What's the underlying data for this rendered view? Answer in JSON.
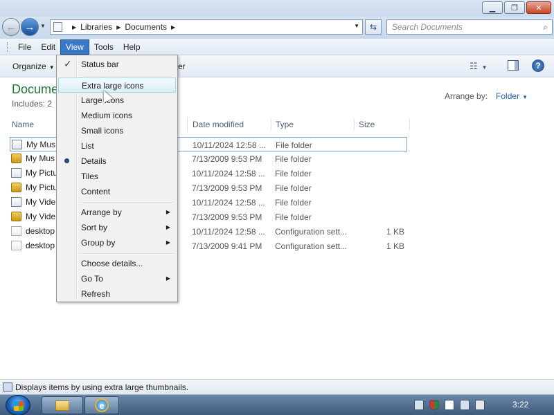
{
  "window": {
    "controls": [
      "minimize",
      "maximize",
      "close"
    ]
  },
  "address": {
    "path": [
      "Libraries",
      "Documents"
    ],
    "search_placeholder": "Search Documents"
  },
  "menubar": {
    "items": [
      "File",
      "Edit",
      "View",
      "Tools",
      "Help"
    ],
    "active": "View"
  },
  "toolbar": {
    "organize": "Organize",
    "partial_hidden": "er"
  },
  "library": {
    "title": "Docume",
    "includes": "Includes:  2",
    "arrange_label": "Arrange by:",
    "arrange_value": "Folder"
  },
  "columns": {
    "name": "Name",
    "date": "Date modified",
    "type": "Type",
    "size": "Size"
  },
  "files": [
    {
      "name": "My Mus",
      "date": "10/11/2024 12:58 ...",
      "type": "File folder",
      "size": "",
      "icon": "library-folder-icon"
    },
    {
      "name": "My Mus",
      "date": "7/13/2009 9:53 PM",
      "type": "File folder",
      "size": "",
      "icon": "locked-folder-icon"
    },
    {
      "name": "My Pictu",
      "date": "10/11/2024 12:58 ...",
      "type": "File folder",
      "size": "",
      "icon": "library-folder-icon"
    },
    {
      "name": "My Pictu",
      "date": "7/13/2009 9:53 PM",
      "type": "File folder",
      "size": "",
      "icon": "locked-folder-icon"
    },
    {
      "name": "My Vide",
      "date": "10/11/2024 12:58 ...",
      "type": "File folder",
      "size": "",
      "icon": "library-folder-icon"
    },
    {
      "name": "My Vide",
      "date": "7/13/2009 9:53 PM",
      "type": "File folder",
      "size": "",
      "icon": "locked-folder-icon"
    },
    {
      "name": "desktop",
      "date": "10/11/2024 12:58 ...",
      "type": "Configuration sett...",
      "size": "1 KB",
      "icon": "config-file-icon"
    },
    {
      "name": "desktop",
      "date": "7/13/2009 9:41 PM",
      "type": "Configuration sett...",
      "size": "1 KB",
      "icon": "config-file-icon"
    }
  ],
  "view_menu": {
    "items": [
      {
        "label": "Status bar",
        "mark": "check"
      },
      {
        "label": "Extra large icons",
        "mark": "",
        "hover": true
      },
      {
        "label": "Large icons",
        "mark": ""
      },
      {
        "label": "Medium icons",
        "mark": ""
      },
      {
        "label": "Small icons",
        "mark": ""
      },
      {
        "label": "List",
        "mark": ""
      },
      {
        "label": "Details",
        "mark": "radio"
      },
      {
        "label": "Tiles",
        "mark": ""
      },
      {
        "label": "Content",
        "mark": ""
      },
      {
        "label": "Arrange by",
        "submenu": true
      },
      {
        "label": "Sort by",
        "submenu": true
      },
      {
        "label": "Group by",
        "submenu": true
      },
      {
        "label": "Choose details...",
        "mark": ""
      },
      {
        "label": "Go To",
        "submenu": true
      },
      {
        "label": "Refresh",
        "mark": ""
      }
    ]
  },
  "status": {
    "text": "Displays items by using extra large thumbnails."
  },
  "taskbar": {
    "clock": "3:22"
  }
}
